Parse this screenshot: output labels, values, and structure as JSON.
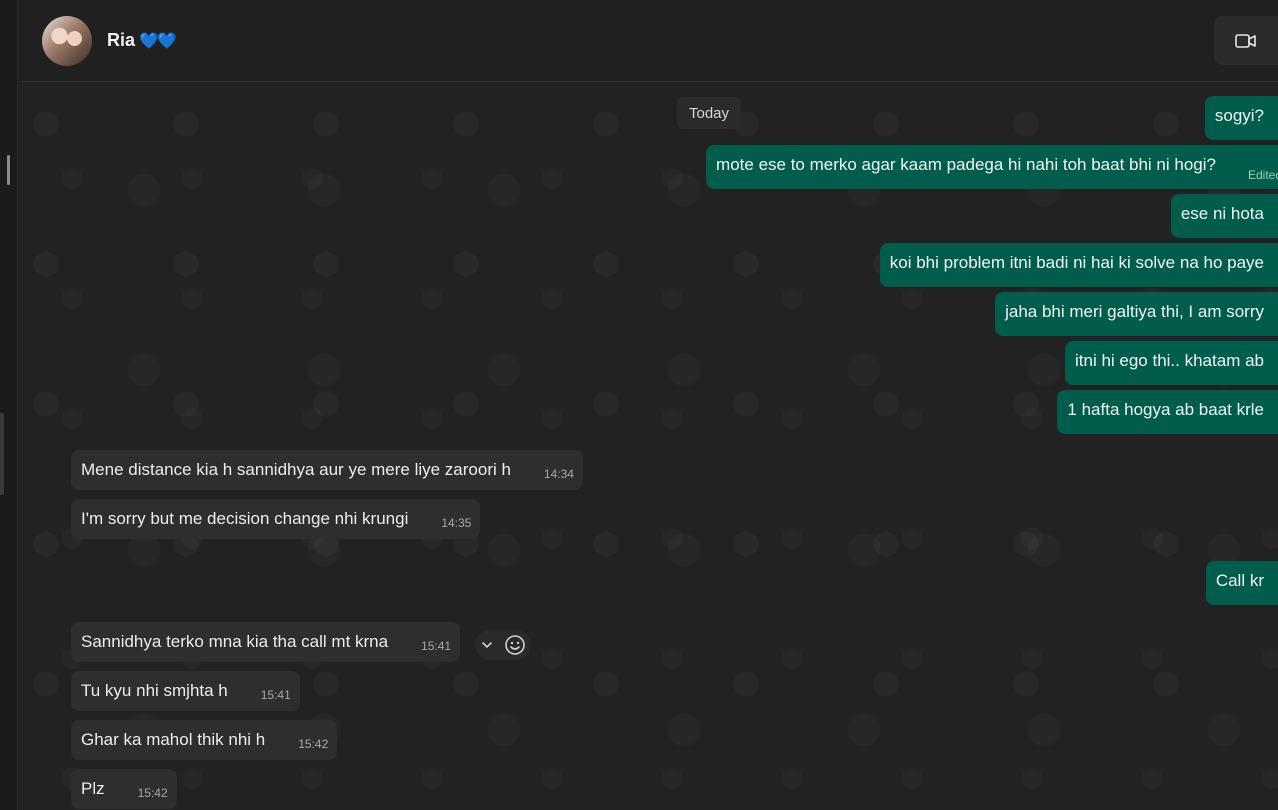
{
  "header": {
    "name": "Ria",
    "hearts": "💙💙"
  },
  "date_chip": "Today",
  "outgoing": [
    {
      "text": "sogyi?"
    },
    {
      "text": "mote ese to merko agar kaam padega hi nahi toh baat bhi ni hogi?",
      "edited": "Edited"
    },
    {
      "text": "ese ni hota"
    },
    {
      "text": "koi bhi problem itni badi ni hai ki solve na ho paye"
    },
    {
      "text": "jaha bhi meri galtiya thi, I am sorry"
    },
    {
      "text": "itni hi ego thi.. khatam ab"
    },
    {
      "text": "1 hafta hogya ab baat krle"
    },
    {
      "text": "Call kr"
    }
  ],
  "incoming": [
    {
      "text": "Mene distance kia h sannidhya aur ye mere liye zaroori h",
      "time": "14:34"
    },
    {
      "text": "I'm sorry but me decision change nhi krungi",
      "time": "14:35"
    },
    {
      "text": "Sannidhya terko mna kia tha call mt krna",
      "time": "15:41"
    },
    {
      "text": "Tu kyu nhi smjhta h",
      "time": "15:41"
    },
    {
      "text": "Ghar ka mahol thik nhi h",
      "time": "15:42"
    },
    {
      "text": "Plz",
      "time": "15:42"
    }
  ],
  "icons": {
    "video": "video-camera-icon",
    "dropdown": "chevron-down-icon",
    "emoji": "emoji-smile-icon"
  }
}
